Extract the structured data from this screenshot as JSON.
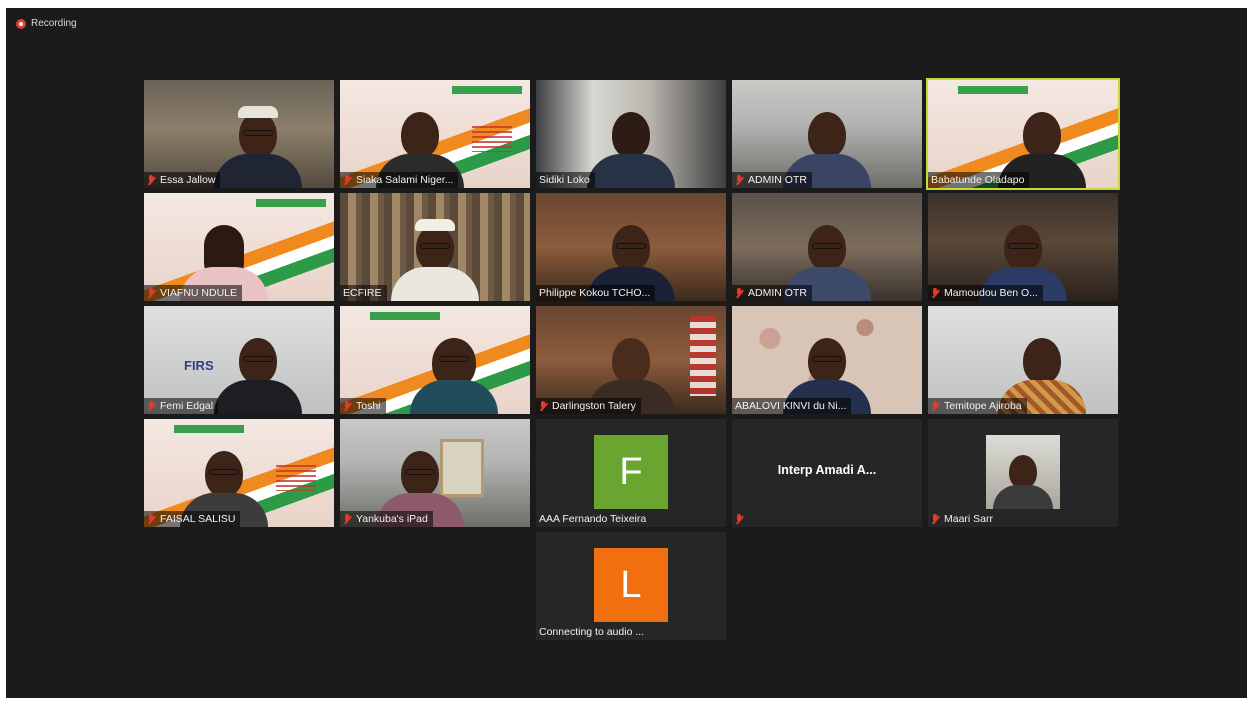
{
  "recording": {
    "label": "Recording"
  },
  "active_speaker": "Babatunde Oladapo",
  "tiles": [
    {
      "name": "Essa Jallow",
      "muted": true
    },
    {
      "name": "Siaka Salami Niger...",
      "muted": true
    },
    {
      "name": "Sidiki Loko",
      "muted": false
    },
    {
      "name": "ADMIN OTR",
      "muted": true
    },
    {
      "name": "Babatunde Oladapo",
      "muted": false
    },
    {
      "name": "VIAFNU NDULE",
      "muted": true
    },
    {
      "name": "ECFIRE",
      "muted": false
    },
    {
      "name": "Philippe Kokou TCHO...",
      "muted": false
    },
    {
      "name": "ADMIN OTR",
      "muted": true
    },
    {
      "name": "Mamoudou Ben O...",
      "muted": true
    },
    {
      "name": "Femi Edgal",
      "muted": true
    },
    {
      "name": "Toshi",
      "muted": true
    },
    {
      "name": "Darlingston Talery",
      "muted": true
    },
    {
      "name": "ABALOVI KINVI du Ni...",
      "muted": false
    },
    {
      "name": "Temitope Ajiroba",
      "muted": true
    },
    {
      "name": "FAISAL SALISU",
      "muted": true
    },
    {
      "name": "Yankuba's iPad",
      "muted": true
    },
    {
      "name": "AAA Fernando Teixeira",
      "muted": false,
      "avatar_letter": "F",
      "avatar_color": "#6aa62f"
    },
    {
      "name": "Interp Amadi A...",
      "muted": true
    },
    {
      "name": "Maari Sarr",
      "muted": true
    },
    {
      "name": "Connecting to audio ...",
      "muted": false,
      "avatar_letter": "L",
      "avatar_color": "#f0700f"
    }
  ],
  "wall_sign": "FIRS",
  "colors": {
    "recording_dot": "#e23c33",
    "active_outline": "#c7d93a",
    "muted_icon": "#e03b2f",
    "background": "#1b1b1b"
  },
  "icons": [
    "recording-dot-icon",
    "muted-mic-icon"
  ]
}
